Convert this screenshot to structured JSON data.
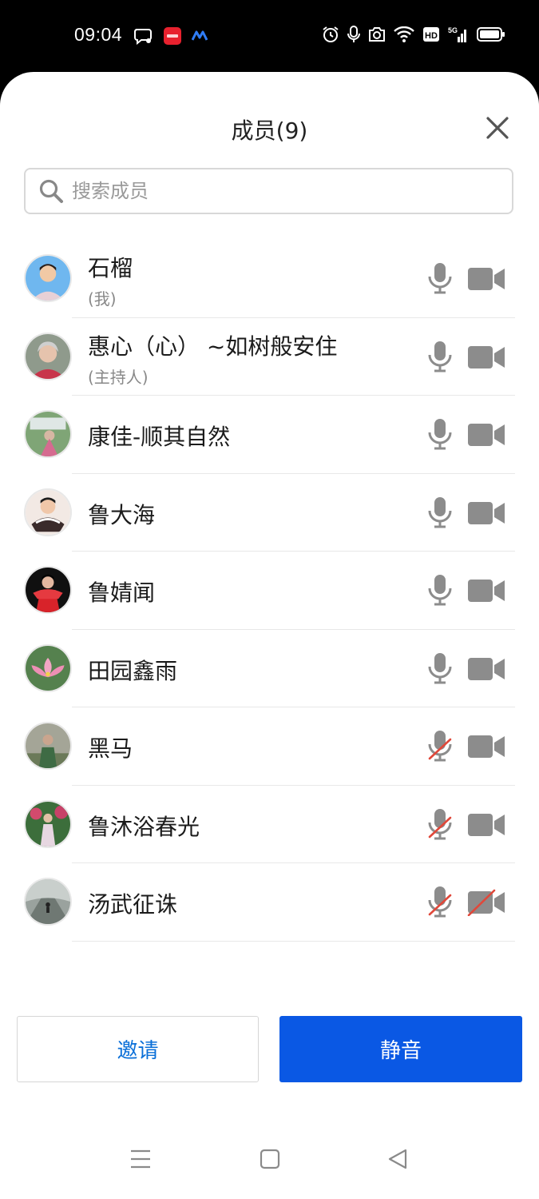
{
  "status_bar": {
    "time": "09:04",
    "left_icons": [
      "chat-bubble-icon",
      "app-badge-icon",
      "app-logo-icon"
    ],
    "right_icons": [
      "alarm-icon",
      "microphone-icon",
      "camera-icon",
      "wifi-icon",
      "hd-icon",
      "signal-5g-icon",
      "battery-icon"
    ],
    "hd_label": "HD",
    "net_label": "5G"
  },
  "sheet": {
    "title": "成员(9)",
    "search": {
      "placeholder": "搜索成员",
      "value": ""
    }
  },
  "members": [
    {
      "name": "石榴",
      "role": "(我)",
      "mic_muted": false,
      "cam_off": false
    },
    {
      "name": "惠心（心） ~如树般安住",
      "role": "(主持人)",
      "mic_muted": false,
      "cam_off": false
    },
    {
      "name": "康佳-顺其自然",
      "role": "",
      "mic_muted": false,
      "cam_off": false
    },
    {
      "name": "鲁大海",
      "role": "",
      "mic_muted": false,
      "cam_off": false
    },
    {
      "name": "鲁婧闻",
      "role": "",
      "mic_muted": false,
      "cam_off": false
    },
    {
      "name": "田园鑫雨",
      "role": "",
      "mic_muted": false,
      "cam_off": false
    },
    {
      "name": "黑马",
      "role": "",
      "mic_muted": true,
      "cam_off": false
    },
    {
      "name": "鲁沐浴春光",
      "role": "",
      "mic_muted": true,
      "cam_off": false
    },
    {
      "name": "汤武征诛",
      "role": "",
      "mic_muted": true,
      "cam_off": true
    }
  ],
  "actions": {
    "invite_label": "邀请",
    "mute_label": "静音"
  },
  "colors": {
    "accent": "#0a58e4",
    "invite_text": "#0a6fd8",
    "icon_grey": "#8c8c8c",
    "muted_slash": "#e0483a"
  }
}
